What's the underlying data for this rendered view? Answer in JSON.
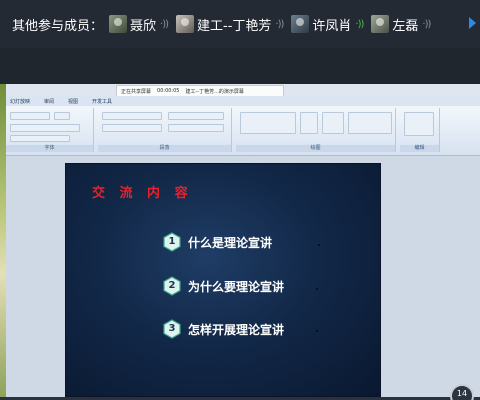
{
  "topbar": {
    "label": "其他参与成员：",
    "members": [
      {
        "name": "聂欣",
        "speaking": false
      },
      {
        "name": "建工--丁艳芳",
        "speaking": false
      },
      {
        "name": "许凤肖",
        "speaking": true
      },
      {
        "name": "左磊",
        "speaking": false
      }
    ],
    "sound_glyph": "·))"
  },
  "sharebar": {
    "status": "正在共享屏幕",
    "meta": "00:00:05",
    "presenter": "建工--丁艳芳...的演示屏幕"
  },
  "ribbon": {
    "tabs": [
      "幻灯放映",
      "审阅",
      "视图",
      "开发工具"
    ],
    "groups": [
      "字体",
      "段落",
      "绘图",
      "编辑"
    ]
  },
  "slide": {
    "title": "交 流 内 容",
    "items": [
      {
        "num": "1",
        "label": "什么是理论宣讲"
      },
      {
        "num": "2",
        "label": "为什么要理论宣讲"
      },
      {
        "num": "3",
        "label": "怎样开展理论宣讲"
      }
    ]
  },
  "page_badge": "14",
  "colors": {
    "title_red": "#e8212b",
    "hex_fill": "#dff3ee",
    "slide_bg": "#122848",
    "speaking_green": "#4ec04e",
    "arrow_blue": "#2a8be6"
  }
}
